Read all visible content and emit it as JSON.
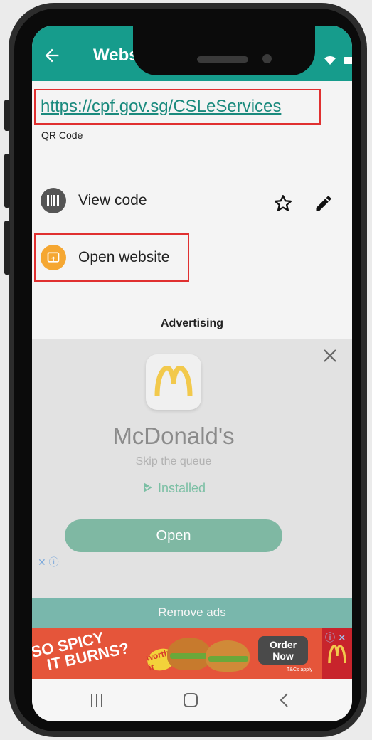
{
  "appbar": {
    "title": "Website"
  },
  "content": {
    "url": "https://cpf.gov.sg/CSLeServices",
    "type": "QR Code",
    "view_code": "View code",
    "open_website": "Open website"
  },
  "ad": {
    "heading": "Advertising",
    "app_name": "McDonald's",
    "tagline": "Skip the queue",
    "installed": "Installed",
    "open": "Open",
    "remove_ads": "Remove ads"
  },
  "banner": {
    "headline_1": "SO SPICY",
    "headline_2": "IT BURNS?",
    "worth": "worth it",
    "order_1": "Order",
    "order_2": "Now",
    "tc": "T&Cs apply"
  },
  "colors": {
    "primary": "#169c8c",
    "highlight": "#e03030",
    "open_icon": "#f5a732"
  }
}
